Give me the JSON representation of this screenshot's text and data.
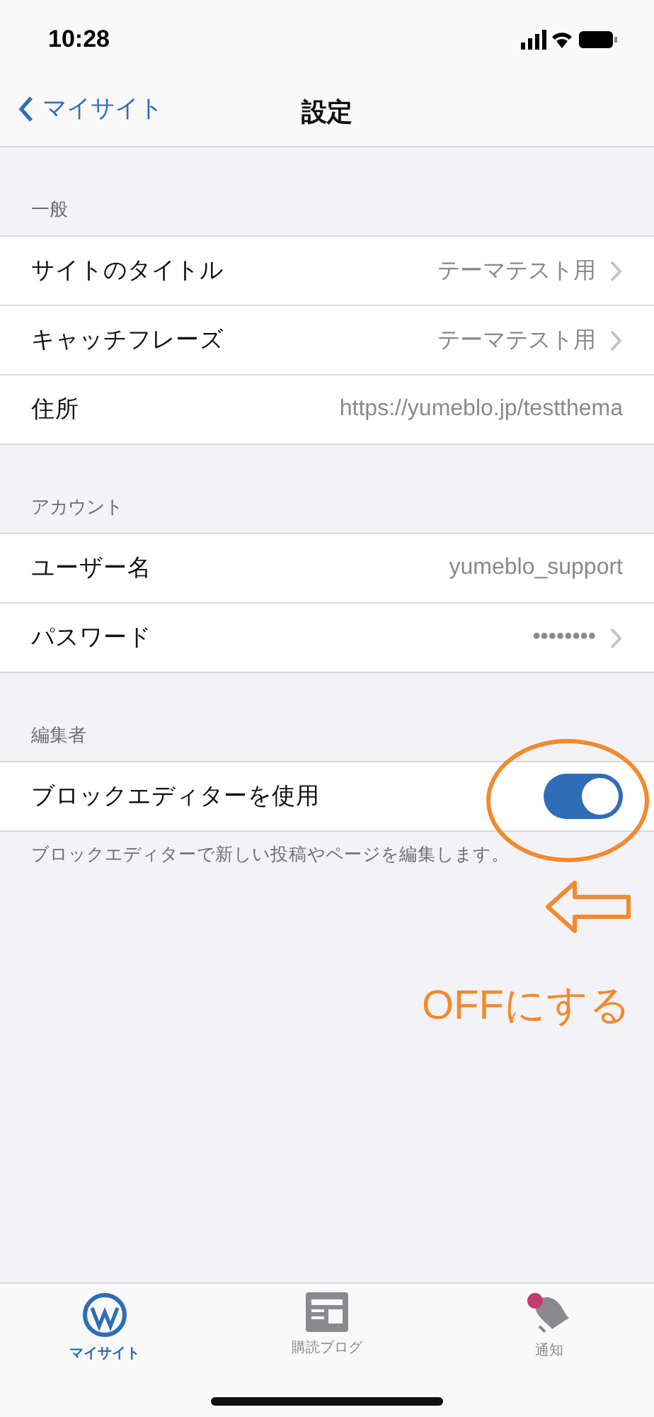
{
  "status_bar": {
    "time": "10:28"
  },
  "nav": {
    "back": "マイサイト",
    "title": "設定"
  },
  "sections": [
    {
      "header": "一般",
      "rows": [
        {
          "kind": "chevron",
          "label": "サイトのタイトル",
          "value": "テーマテスト用"
        },
        {
          "kind": "chevron",
          "label": "キャッチフレーズ",
          "value": "テーマテスト用"
        },
        {
          "kind": "plain",
          "label": "住所",
          "value": "https://yumeblo.jp/testthema"
        }
      ]
    },
    {
      "header": "アカウント",
      "rows": [
        {
          "kind": "plain",
          "label": "ユーザー名",
          "value": "yumeblo_support"
        },
        {
          "kind": "chevron",
          "label": "パスワード",
          "value": "••••••••"
        }
      ]
    },
    {
      "header": "編集者",
      "rows": [
        {
          "kind": "toggle",
          "label": "ブロックエディターを使用",
          "on": true
        }
      ],
      "footer": "ブロックエディターで新しい投稿やページを編集します。"
    }
  ],
  "annotation": {
    "text": "OFFにする"
  },
  "tab_bar": [
    {
      "label": "マイサイト",
      "selected": true
    },
    {
      "label": "購読ブログ",
      "selected": false
    },
    {
      "label": "通知",
      "selected": false
    }
  ]
}
